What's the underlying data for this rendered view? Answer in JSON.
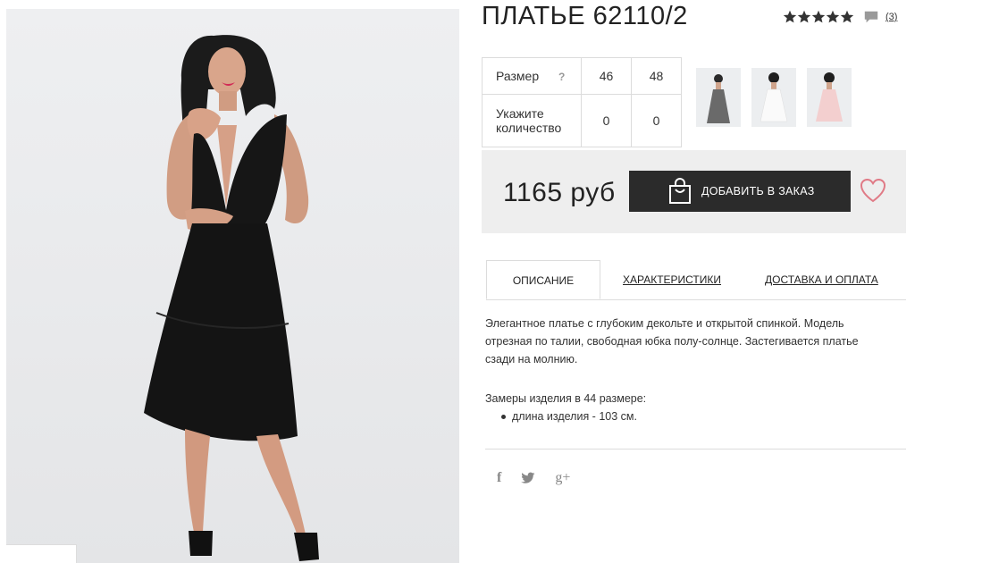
{
  "product": {
    "title": "ПЛАТЬЕ 62110/2",
    "rating_stars": 5,
    "reviews_link": "(3)",
    "icons": {
      "star": "star-icon",
      "comment": "comment-icon"
    }
  },
  "sizes": {
    "header_label": "Размер",
    "help_mark": "?",
    "sizes": [
      "46",
      "48"
    ],
    "quantity_label_line1": "Укажите",
    "quantity_label_line2": "количество",
    "quantities": [
      "0",
      "0"
    ]
  },
  "purchase": {
    "price": "1165 руб",
    "add_button": "ДОБАВИТЬ В ЗАКАЗ",
    "icons": {
      "bag": "shopping-bag-icon",
      "wishlist": "heart-icon"
    },
    "colors": {
      "button_bg": "#2b2b2b",
      "heart": "#e07a86",
      "box_bg": "#eeeeee"
    }
  },
  "tabs": [
    {
      "label": "ОПИСАНИЕ",
      "active": true
    },
    {
      "label": "ХАРАКТЕРИСТИКИ",
      "active": false
    },
    {
      "label": "ДОСТАВКА И ОПЛАТА",
      "active": false
    }
  ],
  "description": {
    "line1": "Элегантное платье с глубоким декольте и открытой спинкой. Модель",
    "line2": "отрезная по талии, свободная юбка полу-солнце. Застегивается платье",
    "line3": "сзади на молнию.",
    "measure_title": "Замеры изделия в 44 размере:",
    "measure_items": [
      "длина изделия - 103 см."
    ]
  },
  "social": {
    "facebook": "f",
    "twitter": "twitter-icon",
    "googleplus": "g+"
  }
}
